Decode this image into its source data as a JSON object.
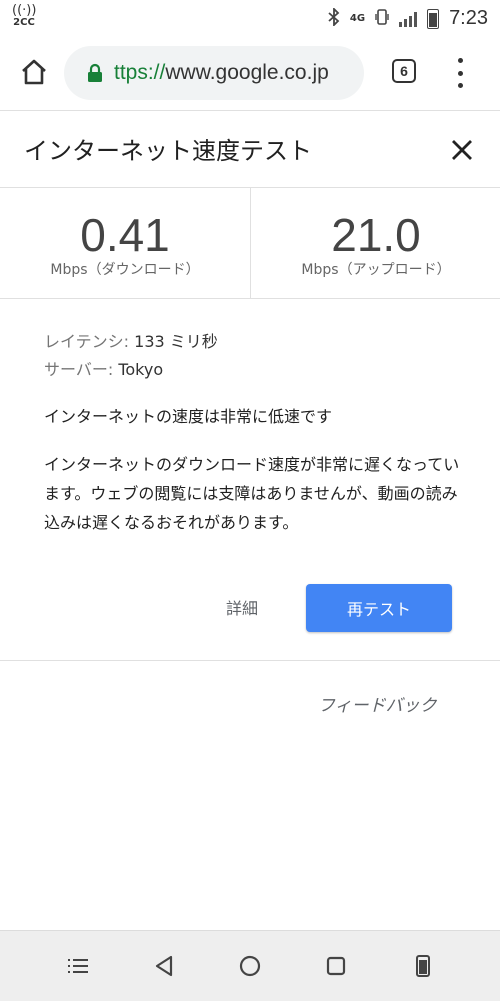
{
  "status_bar": {
    "hotspot_label": "2CC",
    "network": "4G",
    "time": "7:23",
    "battery_level": 0.85,
    "icons": [
      "hotspot-icon",
      "bluetooth-icon",
      "vibrate-icon",
      "signal-icon",
      "battery-icon"
    ]
  },
  "browser": {
    "url_scheme": "ttps://",
    "url_host": "www.google.co.jp",
    "tab_count": "6",
    "secure_color": "#188038"
  },
  "card": {
    "title": "インターネット速度テスト"
  },
  "speeds": {
    "download": {
      "value": "0.41",
      "unit": "Mbps（ダウンロード）"
    },
    "upload": {
      "value": "21.0",
      "unit": "Mbps（アップロード）"
    }
  },
  "details": {
    "latency_label": "レイテンシ:",
    "latency_value": "133 ミリ秒",
    "server_label": "サーバー:",
    "server_value": "Tokyo"
  },
  "summary": "インターネットの速度は非常に低速です",
  "description": "インターネットのダウンロード速度が非常に遅くなっています。ウェブの閲覧には支障はありませんが、動画の読み込みは遅くなるおそれがあります。",
  "actions": {
    "details_label": "詳細",
    "retest_label": "再テスト",
    "accent_color": "#4285f4"
  },
  "feedback_label": "フィードバック"
}
